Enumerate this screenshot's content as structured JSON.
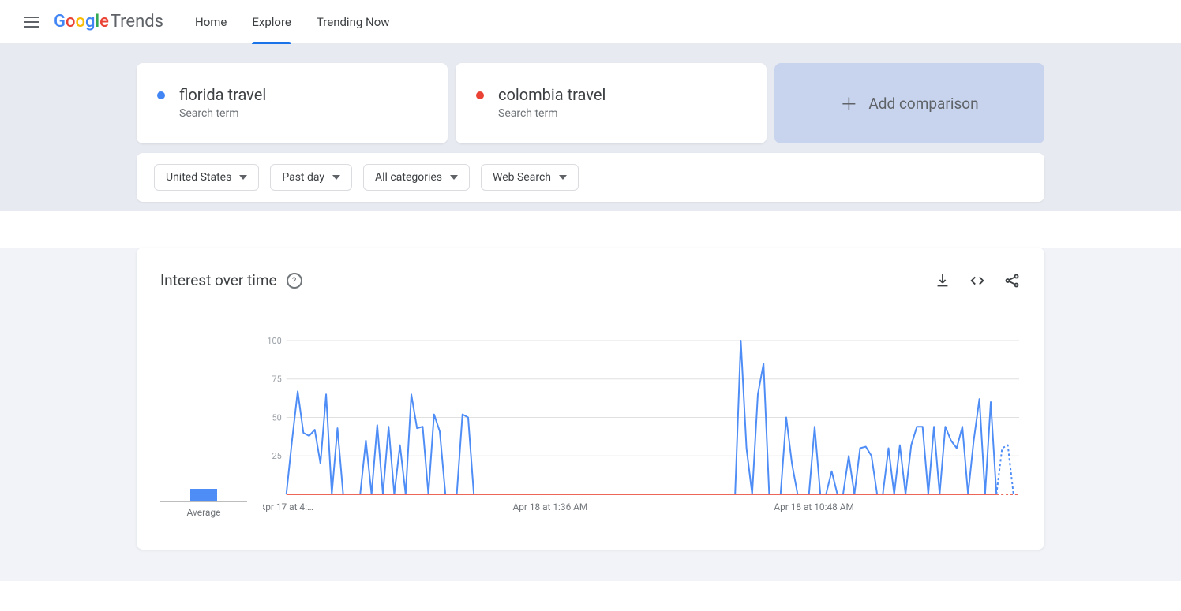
{
  "header": {
    "logo_suffix": "Trends",
    "nav": [
      {
        "label": "Home",
        "active": false
      },
      {
        "label": "Explore",
        "active": true
      },
      {
        "label": "Trending Now",
        "active": false
      }
    ]
  },
  "terms": [
    {
      "name": "florida travel",
      "sub": "Search term",
      "color": "#4285F4"
    },
    {
      "name": "colombia travel",
      "sub": "Search term",
      "color": "#EA4335"
    }
  ],
  "add_comparison_label": "Add comparison",
  "filters": [
    {
      "label": "United States"
    },
    {
      "label": "Past day"
    },
    {
      "label": "All categories"
    },
    {
      "label": "Web Search"
    }
  ],
  "chart": {
    "title": "Interest over time",
    "average_label": "Average",
    "average_values": {
      "florida": 13,
      "colombia": 0
    }
  },
  "chart_data": {
    "type": "line",
    "ylabel": "",
    "xlabel": "",
    "ylim": [
      0,
      100
    ],
    "yticks": [
      25,
      50,
      75,
      100
    ],
    "x_tick_labels": [
      "Apr 17 at 4:…",
      "Apr 18 at 1:36 AM",
      "Apr 18 at 10:48 AM"
    ],
    "x_tick_positions": [
      0,
      0.36,
      0.72
    ],
    "n_points": 130,
    "forecast_start_index": 126,
    "series": [
      {
        "name": "florida travel",
        "color": "#4f8df6",
        "values": [
          0,
          35,
          67,
          40,
          38,
          42,
          20,
          65,
          0,
          43,
          0,
          0,
          0,
          0,
          35,
          0,
          45,
          0,
          44,
          0,
          32,
          0,
          65,
          43,
          44,
          0,
          52,
          41,
          0,
          0,
          0,
          52,
          50,
          0,
          0,
          0,
          0,
          0,
          0,
          0,
          0,
          0,
          0,
          0,
          0,
          0,
          0,
          0,
          0,
          0,
          0,
          0,
          0,
          0,
          0,
          0,
          0,
          0,
          0,
          0,
          0,
          0,
          0,
          0,
          0,
          0,
          0,
          0,
          0,
          0,
          0,
          0,
          0,
          0,
          0,
          0,
          0,
          0,
          0,
          0,
          100,
          30,
          0,
          65,
          85,
          0,
          0,
          0,
          50,
          20,
          0,
          0,
          0,
          44,
          0,
          0,
          15,
          0,
          0,
          25,
          0,
          30,
          31,
          25,
          0,
          0,
          30,
          0,
          32,
          0,
          32,
          44,
          44,
          0,
          44,
          0,
          44,
          35,
          30,
          44,
          0,
          35,
          62,
          0,
          60,
          0,
          30,
          32,
          0,
          0
        ]
      },
      {
        "name": "colombia travel",
        "color": "#ec6759",
        "values": [
          0,
          0,
          0,
          0,
          0,
          0,
          0,
          0,
          0,
          0,
          0,
          0,
          0,
          0,
          0,
          0,
          0,
          0,
          0,
          0,
          0,
          0,
          0,
          0,
          0,
          0,
          0,
          0,
          0,
          0,
          0,
          0,
          0,
          0,
          0,
          0,
          0,
          0,
          0,
          0,
          0,
          0,
          0,
          0,
          0,
          0,
          0,
          0,
          0,
          0,
          0,
          0,
          0,
          0,
          0,
          0,
          0,
          0,
          0,
          0,
          0,
          0,
          0,
          0,
          0,
          0,
          0,
          0,
          0,
          0,
          0,
          0,
          0,
          0,
          0,
          0,
          0,
          0,
          0,
          0,
          0,
          0,
          0,
          0,
          0,
          0,
          0,
          0,
          0,
          0,
          0,
          0,
          0,
          0,
          0,
          0,
          0,
          0,
          0,
          0,
          0,
          0,
          0,
          0,
          0,
          0,
          0,
          0,
          0,
          0,
          0,
          0,
          0,
          0,
          0,
          0,
          0,
          0,
          0,
          0,
          0,
          0,
          0,
          0,
          0,
          0,
          0,
          0,
          0,
          0
        ]
      }
    ]
  }
}
